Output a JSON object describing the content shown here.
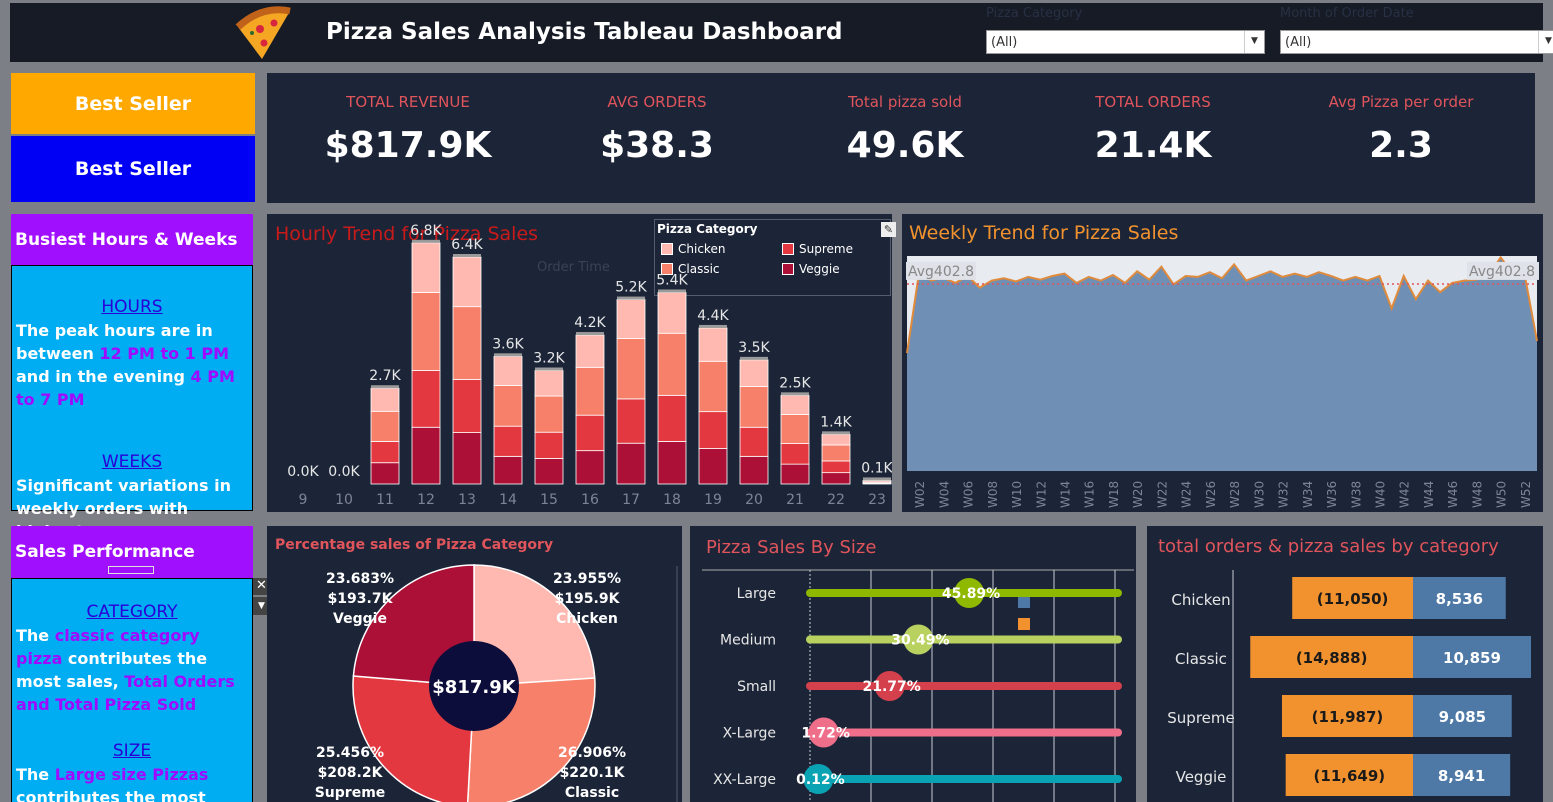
{
  "header": {
    "title": "Pizza Sales Analysis Tableau Dashboard",
    "filters": [
      {
        "label": "Pizza Category",
        "value": "(All)"
      },
      {
        "label": "Month of Order Date",
        "value": "(All)"
      }
    ]
  },
  "left": {
    "best_seller_1": "Best Seller",
    "best_seller_2": "Best Seller",
    "busiest_title": "Busiest  Hours & Weeks",
    "hours_heading": "HOURS",
    "hours_text_1": "The peak hours are in between ",
    "hours_highlight_1": "12 PM to 1 PM",
    "hours_text_2": " and in the evening ",
    "hours_highlight_2": "4 PM to 7 PM",
    "weeks_heading": "WEEKS",
    "weeks_text": "Significant variations in weekly orders with highest ..",
    "sales_perf_title": "Sales Performance",
    "category_heading": "CATEGORY",
    "category_text_1": "The ",
    "category_highlight_1": "classic category pizza",
    "category_text_2": " contributes the most sales, ",
    "category_highlight_2": "Total Orders and Total Pizza Sold",
    "size_heading": "SIZE",
    "size_text_1": "The ",
    "size_highlight_1": "Large size Pizzas",
    "size_text_2": " contributes the most sales."
  },
  "kpis": [
    {
      "label": "TOTAL REVENUE",
      "value": "$817.9K"
    },
    {
      "label": "AVG ORDERS",
      "value": "$38.3"
    },
    {
      "label": "Total  pizza sold",
      "value": "49.6K"
    },
    {
      "label": "TOTAL ORDERS",
      "value": "21.4K"
    },
    {
      "label": "Avg Pizza per order",
      "value": "2.3"
    }
  ],
  "colors": {
    "chicken": "#ffb9b0",
    "classic": "#f7806a",
    "supreme": "#e3383f",
    "veggie": "#ad1036",
    "accent_red": "#e0545b",
    "orange": "#f2922e",
    "steel": "#4e79a7"
  },
  "chart_data": [
    {
      "type": "bar",
      "title": "Hourly Trend for Pizza Sales",
      "xlabel": "Order Time",
      "legend_title": "Pizza Category",
      "legend": [
        "Chicken",
        "Classic",
        "Supreme",
        "Veggie"
      ],
      "categories": [
        "9",
        "10",
        "11",
        "12",
        "13",
        "14",
        "15",
        "16",
        "17",
        "18",
        "19",
        "20",
        "21",
        "22",
        "23"
      ],
      "totals_label": [
        "0.0K",
        "0.0K",
        "2.7K",
        "6.8K",
        "6.4K",
        "3.6K",
        "3.2K",
        "4.2K",
        "5.2K",
        "5.4K",
        "4.4K",
        "3.5K",
        "2.5K",
        "1.4K",
        "0.1K"
      ],
      "series": [
        {
          "name": "Veggie",
          "values": [
            0,
            0,
            600,
            1600,
            1450,
            780,
            720,
            940,
            1150,
            1200,
            1000,
            780,
            560,
            320,
            20
          ]
        },
        {
          "name": "Supreme",
          "values": [
            0,
            0,
            600,
            1600,
            1500,
            850,
            740,
            1000,
            1250,
            1300,
            1040,
            820,
            580,
            330,
            20
          ]
        },
        {
          "name": "Classic",
          "values": [
            0,
            0,
            850,
            2200,
            2050,
            1150,
            1020,
            1350,
            1700,
            1750,
            1420,
            1150,
            820,
            450,
            40
          ]
        },
        {
          "name": "Chicken",
          "values": [
            0,
            0,
            650,
            1400,
            1400,
            820,
            720,
            910,
            1100,
            1150,
            940,
            750,
            540,
            300,
            20
          ]
        }
      ],
      "ylim": [
        0,
        7500
      ]
    },
    {
      "type": "area",
      "title": "Weekly Trend  for Pizza Sales",
      "reference_label": "Avg402.8",
      "average": 402.8,
      "x": [
        "W01",
        "W02",
        "W03",
        "W04",
        "W05",
        "W06",
        "W07",
        "W08",
        "W09",
        "W10",
        "W11",
        "W12",
        "W13",
        "W14",
        "W15",
        "W16",
        "W17",
        "W18",
        "W19",
        "W20",
        "W21",
        "W22",
        "W23",
        "W24",
        "W25",
        "W26",
        "W27",
        "W28",
        "W29",
        "W30",
        "W31",
        "W32",
        "W33",
        "W34",
        "W35",
        "W36",
        "W37",
        "W38",
        "W39",
        "W40",
        "W41",
        "W42",
        "W43",
        "W44",
        "W45",
        "W46",
        "W47",
        "W48",
        "W49",
        "W50",
        "W51",
        "W52",
        "W53"
      ],
      "tick_labels": [
        "W02",
        "W04",
        "W06",
        "W08",
        "W10",
        "W12",
        "W14",
        "W16",
        "W18",
        "W20",
        "W22",
        "W24",
        "W26",
        "W28",
        "W30",
        "W32",
        "W34",
        "W36",
        "W38",
        "W40",
        "W42",
        "W44",
        "W46",
        "W48",
        "W50",
        "W52"
      ],
      "values": [
        254,
        427,
        410,
        416,
        405,
        420,
        395,
        410,
        415,
        408,
        418,
        412,
        420,
        425,
        405,
        418,
        410,
        422,
        405,
        430,
        412,
        440,
        402,
        420,
        418,
        428,
        415,
        445,
        410,
        420,
        430,
        418,
        425,
        418,
        428,
        420,
        410,
        418,
        410,
        420,
        350,
        420,
        370,
        410,
        385,
        405,
        410,
        412,
        422,
        460,
        425,
        420,
        280
      ]
    },
    {
      "type": "pie",
      "title": "Percentage sales of Pizza Category",
      "center_label": "$817.9K",
      "slices": [
        {
          "name": "Chicken",
          "pct": "23.955%",
          "value": "$195.9K",
          "share": 23.955
        },
        {
          "name": "Classic",
          "pct": "26.906%",
          "value": "$220.1K",
          "share": 26.906
        },
        {
          "name": "Supreme",
          "pct": "25.456%",
          "value": "$208.2K",
          "share": 25.456
        },
        {
          "name": "Veggie",
          "pct": "23.683%",
          "value": "$193.7K",
          "share": 23.683
        }
      ]
    },
    {
      "type": "bar",
      "title": "Pizza Sales By Size",
      "categories": [
        "Large",
        "Medium",
        "Small",
        "X-Large",
        "XX-Large"
      ],
      "values": [
        45.89,
        30.49,
        21.77,
        1.72,
        0.12
      ],
      "labels": [
        "45.89%",
        "30.49%",
        "21.77%",
        "1.72%",
        "0.12%"
      ],
      "colors": [
        "#8fb800",
        "#b9d15f",
        "#d5404d",
        "#ef6e8a",
        "#0aa3b3"
      ]
    },
    {
      "type": "bar",
      "title": "total orders & pizza sales by category",
      "categories": [
        "Chicken",
        "Classic",
        "Supreme",
        "Veggie"
      ],
      "series": [
        {
          "values": [
            11050,
            14888,
            11987,
            11649
          ],
          "labels": [
            "(11,050)",
            "(14,888)",
            "(11,987)",
            "(11,649)"
          ]
        },
        {
          "values": [
            8536,
            10859,
            9085,
            8941
          ],
          "labels": [
            "8,536",
            "10,859",
            "9,085",
            "8,941"
          ]
        }
      ]
    }
  ]
}
